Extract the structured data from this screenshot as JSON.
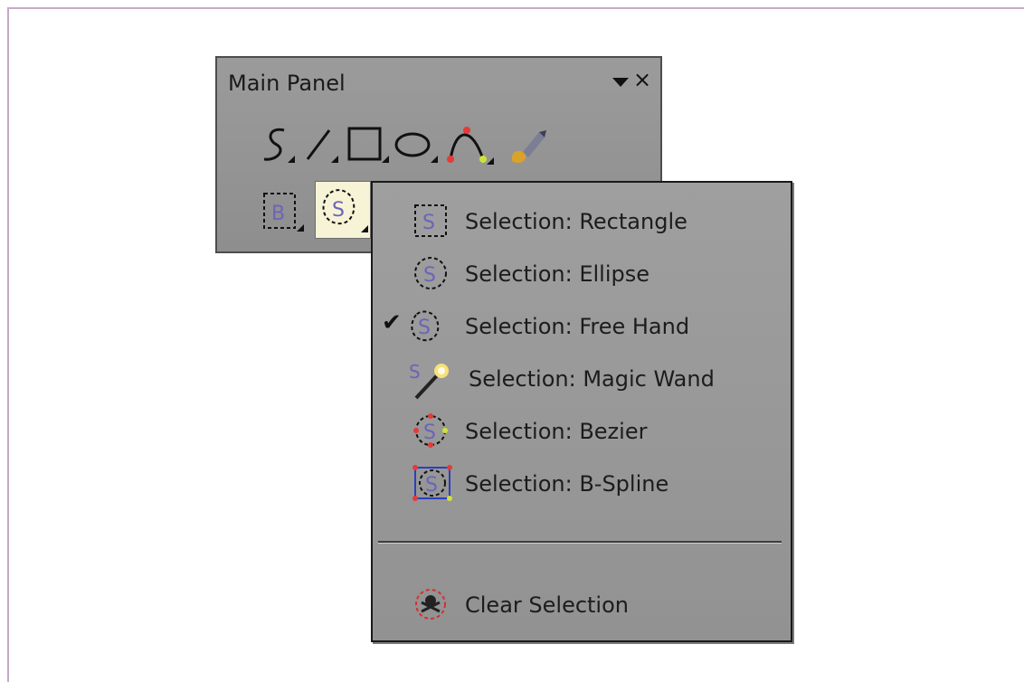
{
  "panel": {
    "title": "Main Panel",
    "close_glyph": "×",
    "tools_row1": [
      "freehand-curve-icon",
      "line-icon",
      "rectangle-icon",
      "ellipse-icon",
      "bezier-curve-icon",
      "paint-brush-icon"
    ],
    "tools_row2": [
      "bspline-selection-tool-icon",
      "freehand-selection-tool-icon"
    ]
  },
  "menu": {
    "items": [
      {
        "label": "Selection: Rectangle",
        "icon": "rectangle-selection-icon",
        "checked": false
      },
      {
        "label": "Selection: Ellipse",
        "icon": "ellipse-selection-icon",
        "checked": false
      },
      {
        "label": "Selection: Free Hand",
        "icon": "freehand-selection-icon",
        "checked": true
      },
      {
        "label": "Selection: Magic Wand",
        "icon": "magic-wand-icon",
        "checked": false
      },
      {
        "label": "Selection: Bezier",
        "icon": "bezier-selection-icon",
        "checked": false
      },
      {
        "label": "Selection: B-Spline",
        "icon": "bspline-selection-icon",
        "checked": false
      }
    ],
    "clear": {
      "label": "Clear Selection",
      "icon": "clear-selection-icon"
    },
    "check_glyph": "✔"
  },
  "colors": {
    "panel_bg": "#999999",
    "menu_bg": "#9a9a9a",
    "selected_tool_bg": "#f7f3d6",
    "icon_purple": "#6a65b8"
  }
}
